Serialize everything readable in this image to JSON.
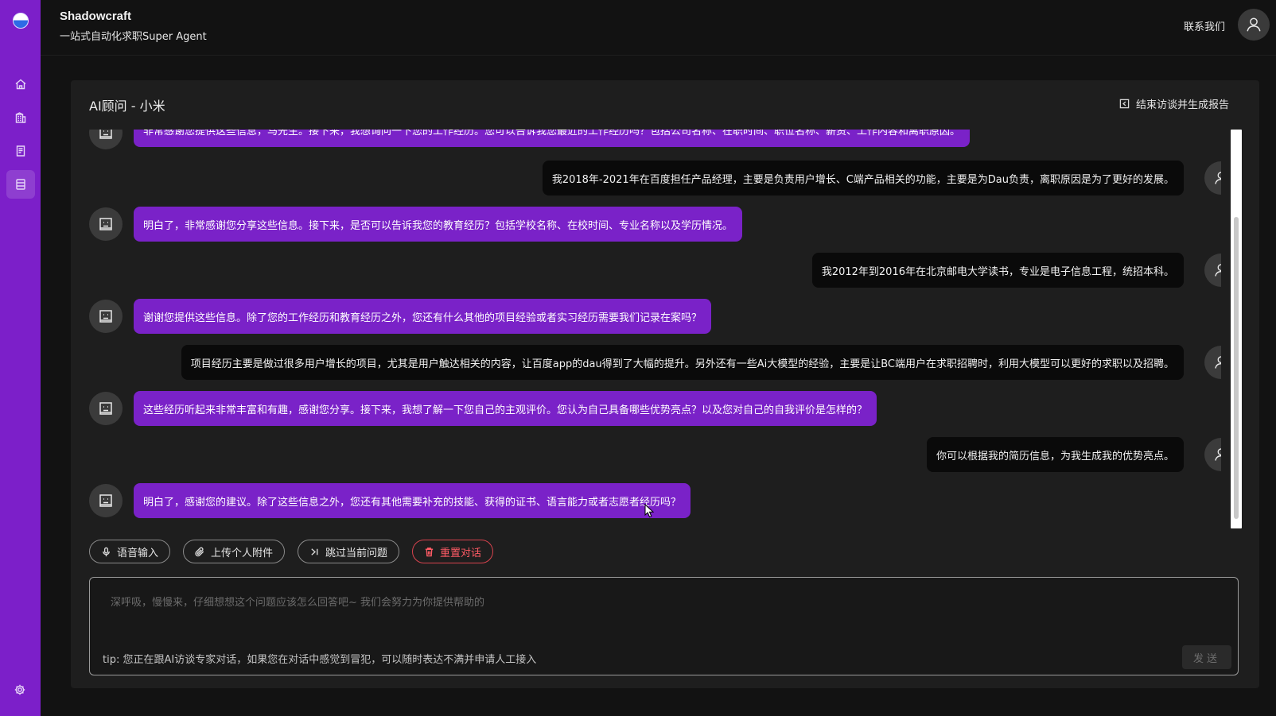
{
  "app": {
    "title": "Shadowcraft",
    "subtitle": "一站式自动化求职Super Agent",
    "contact_label": "联系我们"
  },
  "sidebar": {
    "items": [
      {
        "icon": "home-icon"
      },
      {
        "icon": "building-icon"
      },
      {
        "icon": "document-icon"
      },
      {
        "icon": "list-icon",
        "active": true
      }
    ],
    "settings_icon": "gear-icon"
  },
  "panel": {
    "title": "AI顾问 - 小米",
    "end_label": "结束访谈并生成报告"
  },
  "messages": [
    {
      "role": "bot",
      "text": "非常感谢您提供这些信息，马先生。接下来，我想询问一下您的工作经历。您可以告诉我您最近的工作经历吗？包括公司名称、在职时间、职位名称、薪资、工作内容和离职原因。"
    },
    {
      "role": "user",
      "text": "我2018年-2021年在百度担任产品经理，主要是负责用户增长、C端产品相关的功能，主要是为Dau负责，离职原因是为了更好的发展。"
    },
    {
      "role": "bot",
      "text": "明白了，非常感谢您分享这些信息。接下来，是否可以告诉我您的教育经历？包括学校名称、在校时间、专业名称以及学历情况。"
    },
    {
      "role": "user",
      "text": "我2012年到2016年在北京邮电大学读书，专业是电子信息工程，统招本科。"
    },
    {
      "role": "bot",
      "text": "谢谢您提供这些信息。除了您的工作经历和教育经历之外，您还有什么其他的项目经验或者实习经历需要我们记录在案吗？"
    },
    {
      "role": "user",
      "text": "项目经历主要是做过很多用户增长的项目，尤其是用户触达相关的内容，让百度app的dau得到了大幅的提升。另外还有一些Ai大模型的经验，主要是让BC端用户在求职招聘时，利用大模型可以更好的求职以及招聘。"
    },
    {
      "role": "bot",
      "text": "这些经历听起来非常丰富和有趣，感谢您分享。接下来，我想了解一下您自己的主观评价。您认为自己具备哪些优势亮点？以及您对自己的自我评价是怎样的？"
    },
    {
      "role": "user",
      "text": "你可以根据我的简历信息，为我生成我的优势亮点。"
    },
    {
      "role": "bot",
      "text": "明白了，感谢您的建议。除了这些信息之外，您还有其他需要补充的技能、获得的证书、语言能力或者志愿者经历吗？"
    }
  ],
  "actions": {
    "voice": "语音输入",
    "upload": "上传个人附件",
    "skip": "跳过当前问题",
    "reset": "重置对话"
  },
  "input": {
    "placeholder": "深呼吸，慢慢来，仔细想想这个问题应该怎么回答吧~ 我们会努力为你提供帮助的",
    "tip": "tip: 您正在跟AI访谈专家对话，如果您在对话中感觉到冒犯，可以随时表达不满并申请人工接入",
    "send": "发送"
  },
  "colors": {
    "sidebar": "#7c1fc9",
    "bot_bubble": "#7a22c8",
    "user_bubble": "#0a0a0a",
    "danger": "#ff5b65"
  }
}
